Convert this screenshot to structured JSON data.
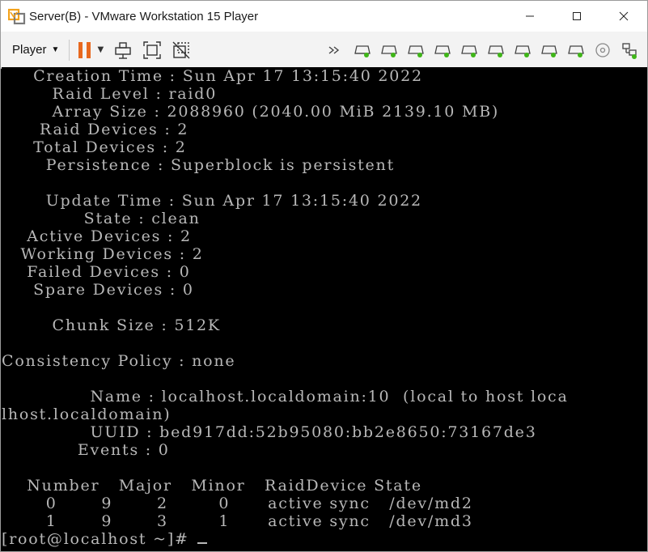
{
  "window": {
    "title": "Server(B) - VMware Workstation 15 Player"
  },
  "toolbar": {
    "player_label": "Player",
    "icons": [
      "pause-icon",
      "send-ctrl-alt-del-icon",
      "fit-guest-icon",
      "unity-icon"
    ],
    "device_icons": [
      "more-devices-icon",
      "hdd-icon",
      "hdd-icon",
      "hdd-icon",
      "hdd-icon",
      "hdd-icon",
      "hdd-icon",
      "hdd-icon",
      "hdd-icon",
      "hdd-icon",
      "cd-icon",
      "network-icon"
    ]
  },
  "colors": {
    "pause": "#e8681e",
    "led_green": "#3fb618",
    "terminal_fg": "#b8b8b8",
    "terminal_bg": "#000000"
  },
  "terminal": {
    "lines": [
      "     Creation Time : Sun Apr 17 13:15:40 2022",
      "        Raid Level : raid0",
      "        Array Size : 2088960 (2040.00 MiB 2139.10 MB)",
      "      Raid Devices : 2",
      "     Total Devices : 2",
      "       Persistence : Superblock is persistent",
      "",
      "       Update Time : Sun Apr 17 13:15:40 2022",
      "             State : clean",
      "    Active Devices : 2",
      "   Working Devices : 2",
      "    Failed Devices : 0",
      "     Spare Devices : 0",
      "",
      "        Chunk Size : 512K",
      "",
      "Consistency Policy : none",
      "",
      "              Name : localhost.localdomain:10  (local to host loca",
      "lhost.localdomain)",
      "              UUID : bed917dd:52b95080:bb2e8650:73167de3",
      "            Events : 0",
      "",
      "    Number   Major   Minor   RaidDevice State",
      "       0       9       2        0      active sync   /dev/md2",
      "       1       9       3        1      active sync   /dev/md3"
    ],
    "prompt": "[root@localhost ~]# "
  }
}
